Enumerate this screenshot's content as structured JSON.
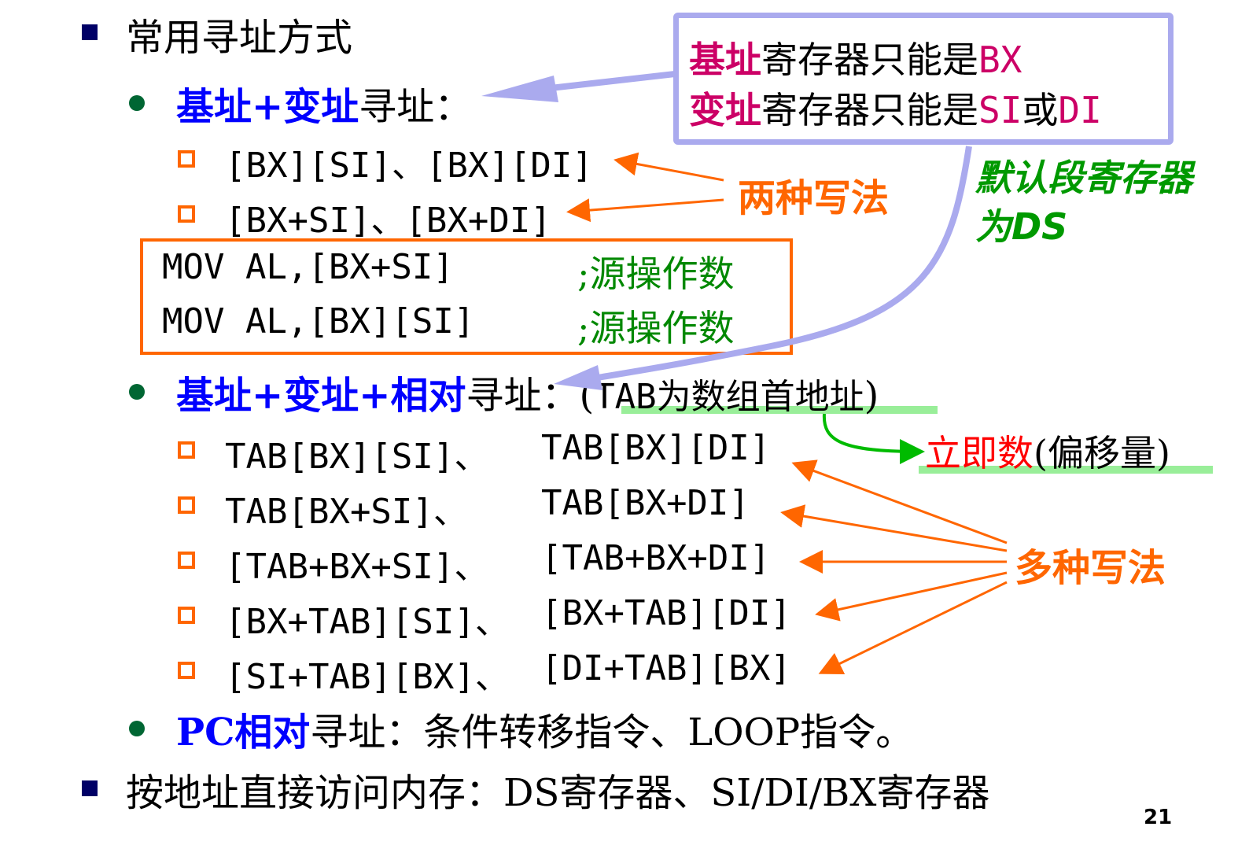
{
  "heading": "常用寻址方式",
  "base_index": {
    "title_colored": "基址+变址",
    "title_rest": "寻址：",
    "items": [
      "[BX][SI]、[BX][DI]",
      "[BX+SI]、[BX+DI]"
    ]
  },
  "code_box": {
    "lines": [
      {
        "instr": "MOV AL,[BX+SI]",
        "comment": ";源操作数"
      },
      {
        "instr": "MOV AL,[BX][SI]",
        "comment": ";源操作数"
      }
    ]
  },
  "callout": {
    "line1": {
      "colored": "基址",
      "rest": "寄存器只能是",
      "reg": "BX"
    },
    "line2": {
      "colored": "变址",
      "rest": "寄存器只能是",
      "reg1": "SI",
      "or": "或",
      "reg2": "DI"
    }
  },
  "two_ways": "两种写法",
  "default_seg": {
    "line1": "默认段寄存器",
    "line2": "为DS"
  },
  "base_index_rel": {
    "title_colored": "基址+变址+相对",
    "title_rest": "寻址：(",
    "note": "TAB为数组首地址",
    "close": ")",
    "rows": [
      {
        "left": "TAB[BX][SI]、",
        "right": "TAB[BX][DI]"
      },
      {
        "left": "TAB[BX+SI]、",
        "right": "TAB[BX+DI]"
      },
      {
        "left": "[TAB+BX+SI]、",
        "right": "[TAB+BX+DI]"
      },
      {
        "left": "[BX+TAB][SI]、",
        "right": "[BX+TAB][DI]"
      },
      {
        "left": "[SI+TAB][BX]、",
        "right": "[DI+TAB][BX]"
      }
    ]
  },
  "immediate": {
    "colored": "立即数",
    "rest": "(偏移量)"
  },
  "many_ways": "多种写法",
  "pc_rel": {
    "colored": "PC相对",
    "rest": "寻址：条件转移指令、LOOP指令。"
  },
  "mem_access": "按地址直接访问内存：DS寄存器、SI/DI/BX寄存器",
  "page_number": "21",
  "colors": {
    "blue": "#0000ff",
    "magenta": "#cc0066",
    "orange": "#ff6600",
    "green": "#009900",
    "purple_box": "#aaaaee"
  }
}
